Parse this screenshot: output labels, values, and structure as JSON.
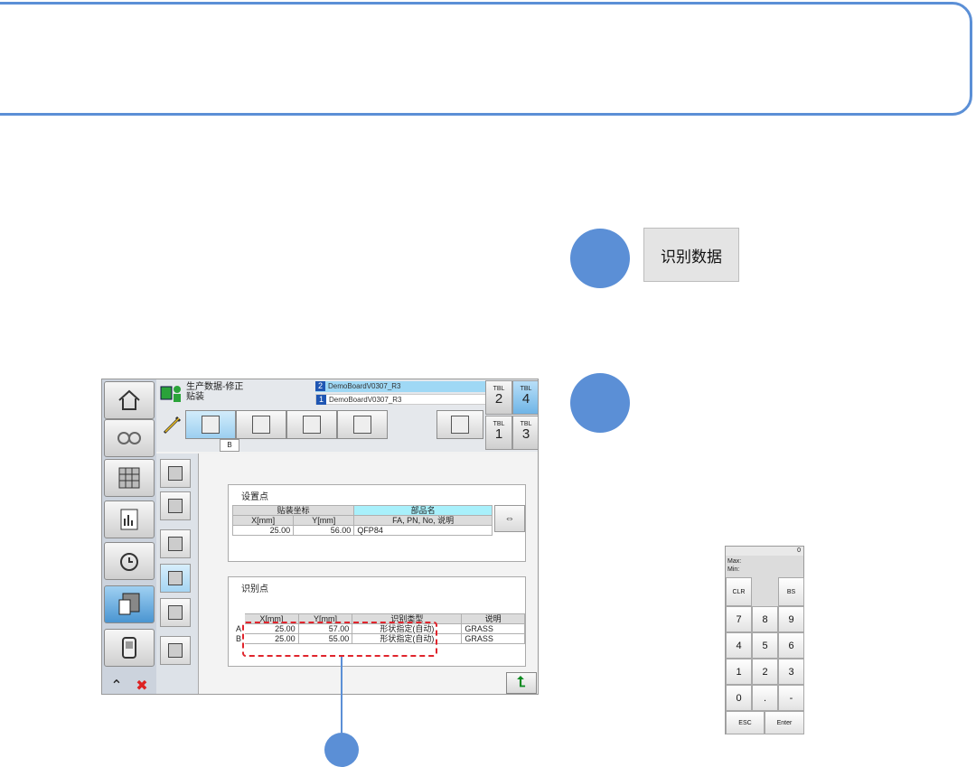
{
  "recognize_button_label": "识别数据",
  "screen": {
    "header": {
      "title_line1": "生产数据-修正",
      "title_line2": "贴装",
      "program_primary": {
        "num": "2",
        "name": "DemoBoardV0307_R3"
      },
      "program_secondary": {
        "num": "1",
        "name": "DemoBoardV0307_R3"
      },
      "tab_label": "B"
    },
    "table_buttons": [
      {
        "label": "TBL",
        "num": "2"
      },
      {
        "label": "TBL",
        "num": "4"
      },
      {
        "label": "TBL",
        "num": "1"
      },
      {
        "label": "TBL",
        "num": "3"
      }
    ],
    "placement_panel": {
      "title": "设置点",
      "group_header": "贴装坐标",
      "part_header": "部品名",
      "col_x": "X[mm]",
      "col_y": "Y[mm]",
      "col_info": "FA, PN, No, 说明",
      "row": {
        "x": "25.00",
        "y": "56.00",
        "part": "QFP84"
      },
      "swap_symbol": "⇔"
    },
    "recognition_panel": {
      "title": "识别点",
      "col_x": "X[mm]",
      "col_y": "Y[mm]",
      "col_type": "识别类型",
      "col_desc": "说明",
      "rows": [
        {
          "id": "A",
          "x": "25.00",
          "y": "57.00",
          "type": "形状指定(自动)",
          "desc": "GRASS"
        },
        {
          "id": "B",
          "x": "25.00",
          "y": "55.00",
          "type": "形状指定(自动)",
          "desc": "GRASS"
        }
      ]
    }
  },
  "keypad": {
    "display": "0",
    "max_label": "Max:",
    "min_label": "Min:",
    "clr": "CLR",
    "bs": "BS",
    "digits": [
      "7",
      "8",
      "9",
      "4",
      "5",
      "6",
      "1",
      "2",
      "3",
      "0",
      ".",
      "-"
    ],
    "esc": "ESC",
    "enter": "Enter"
  }
}
